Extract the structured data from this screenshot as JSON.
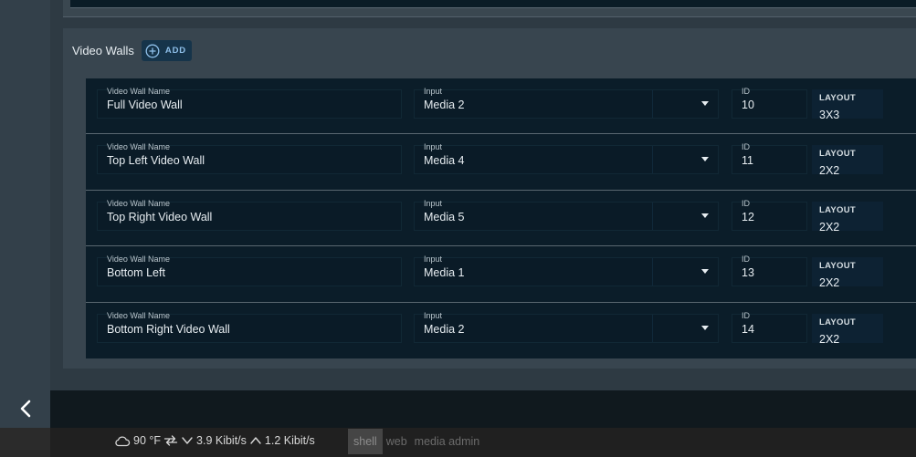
{
  "video_walls": {
    "title": "Video Walls",
    "add_label": "ADD",
    "name_label": "Video Wall Name",
    "input_label": "Input",
    "id_label": "ID",
    "layout_label": "LAYOUT",
    "rows": [
      {
        "name": "Full Video Wall",
        "input": "Media 2",
        "id": "10",
        "layout": "3X3"
      },
      {
        "name": "Top Left Video Wall",
        "input": "Media 4",
        "id": "11",
        "layout": "2X2"
      },
      {
        "name": "Top Right Video Wall",
        "input": "Media 5",
        "id": "12",
        "layout": "2X2"
      },
      {
        "name": "Bottom Left",
        "input": "Media 1",
        "id": "13",
        "layout": "2X2"
      },
      {
        "name": "Bottom Right Video Wall",
        "input": "Media 2",
        "id": "14",
        "layout": "2X2"
      }
    ]
  },
  "status_bar": {
    "weather": "90 °F",
    "download": "3.9 Kibit/s",
    "upload": "1.2 Kibit/s",
    "icons": [
      "cloud-icon",
      "transfer-icon",
      "chevron-down-icon",
      "chevron-up-icon"
    ]
  },
  "tabs": [
    {
      "label": "shell",
      "active": true
    },
    {
      "label": "web",
      "active": false
    },
    {
      "label": "media admin",
      "active": false
    }
  ],
  "colors": {
    "page_bg": "#2e3a43",
    "list_bg": "#0b1d29",
    "accent": "#8fc0ea",
    "add_button_bg": "#16344a"
  }
}
